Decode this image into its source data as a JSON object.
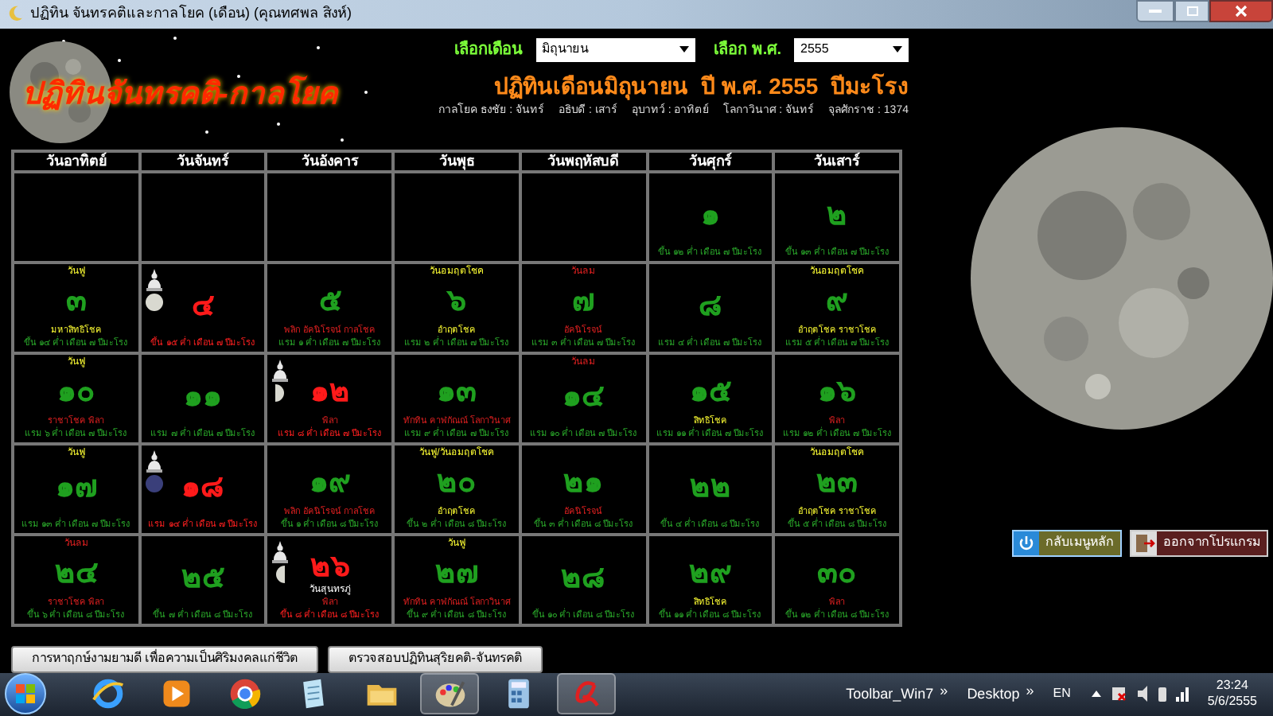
{
  "window": {
    "title": "ปฏิทิน จันทรคติและกาลโยค (เดือน) (คุณทศพล สิงห์)"
  },
  "logo": {
    "text": "ปฏิทินจันทรคติ-กาลโยค"
  },
  "month_select": {
    "label": "เลือกเดือน",
    "value": "มิถุนายน"
  },
  "year_select": {
    "label": "เลือก พ.ศ.",
    "value": "2555"
  },
  "heading": "ปฏิทินเดือนมิถุนายน  ปี พ.ศ. 2555  ปีมะโรง",
  "info": [
    "กาลโยค ธงชัย : จันทร์",
    "อธิบดี : เสาร์",
    "อุบาทว์ : อาทิตย์",
    "โลกาวินาศ : จันทร์",
    "จุลศักราช : 1374"
  ],
  "calendar": {
    "weekdays": [
      "วันอาทิตย์",
      "วันจันทร์",
      "วันอังคาร",
      "วันพุธ",
      "วันพฤหัสบดี",
      "วันศุกร์",
      "วันเสาร์"
    ],
    "weeks": [
      [
        {
          "kind": "blank"
        },
        {
          "kind": "blank"
        },
        {
          "kind": "blank"
        },
        {
          "kind": "blank"
        },
        {
          "kind": "blank"
        },
        {
          "kind": "day",
          "day": "๑",
          "lunar": "ขึ้น ๑๒ ค่ำ เดือน ๗ ปีมะโรง"
        },
        {
          "kind": "day",
          "day": "๒",
          "lunar": "ขึ้น ๑๓ ค่ำ เดือน ๗ ปีมะโรง"
        }
      ],
      [
        {
          "kind": "day",
          "day": "๓",
          "label": {
            "text": "วันฟู",
            "kind": "good"
          },
          "note": {
            "text": "มหาสิทธิโชค",
            "kind": "good"
          },
          "lunar": "ขึ้น ๑๔ ค่ำ เดือน ๗ ปีมะโรง"
        },
        {
          "kind": "day",
          "day": "๔",
          "moon": {
            "kind": "full"
          },
          "lunar": "ขึ้น ๑๕ ค่ำ เดือน ๗ ปีมะโรง"
        },
        {
          "kind": "day",
          "day": "๕",
          "note": {
            "text": "พลิก อัคนิโรจน์ กาลโชค",
            "kind": "bad"
          },
          "lunar": "แรม ๑ ค่ำ เดือน ๗ ปีมะโรง"
        },
        {
          "kind": "day",
          "day": "๖",
          "label": {
            "text": "วันอมฤตโชค",
            "kind": "good"
          },
          "note": {
            "text": "อำฤตโชค",
            "kind": "good"
          },
          "lunar": "แรม ๒ ค่ำ เดือน ๗ ปีมะโรง"
        },
        {
          "kind": "day",
          "day": "๗",
          "label": {
            "text": "วันลม",
            "kind": "bad"
          },
          "note": {
            "text": "อัคนิโรจน์",
            "kind": "bad"
          },
          "lunar": "แรม ๓ ค่ำ เดือน ๗ ปีมะโรง"
        },
        {
          "kind": "day",
          "day": "๘",
          "lunar": "แรม ๔ ค่ำ เดือน ๗ ปีมะโรง"
        },
        {
          "kind": "day",
          "day": "๙",
          "label": {
            "text": "วันอมฤตโชค",
            "kind": "good"
          },
          "note": {
            "text": "อำฤตโชค ราชาโชค",
            "kind": "good"
          },
          "lunar": "แรม ๕ ค่ำ เดือน ๗ ปีมะโรง"
        }
      ],
      [
        {
          "kind": "day",
          "day": "๑๐",
          "label": {
            "text": "วันฟู",
            "kind": "good"
          },
          "note": {
            "text": "ราชาโชค พิลา",
            "kind": "bad"
          },
          "lunar": "แรม ๖ ค่ำ เดือน ๗ ปีมะโรง"
        },
        {
          "kind": "day",
          "day": "๑๑",
          "lunar": "แรม ๗ ค่ำ เดือน ๗ ปีมะโรง"
        },
        {
          "kind": "day",
          "day": "๑๒",
          "moon": {
            "kind": "waning_half"
          },
          "note": {
            "text": "พิลา",
            "kind": "bad"
          },
          "lunar": "แรม ๘ ค่ำ เดือน ๗ ปีมะโรง"
        },
        {
          "kind": "day",
          "day": "๑๓",
          "note": {
            "text": "ทักทิน คาฬกัณณ์ โลกาวินาศ",
            "kind": "bad"
          },
          "lunar": "แรม ๙ ค่ำ เดือน ๗ ปีมะโรง"
        },
        {
          "kind": "day",
          "day": "๑๔",
          "label": {
            "text": "วันลม",
            "kind": "bad"
          },
          "lunar": "แรม ๑๐ ค่ำ เดือน ๗ ปีมะโรง"
        },
        {
          "kind": "day",
          "day": "๑๕",
          "note": {
            "text": "สิทธิโชค",
            "kind": "good"
          },
          "lunar": "แรม ๑๑ ค่ำ เดือน ๗ ปีมะโรง"
        },
        {
          "kind": "day",
          "day": "๑๖",
          "note": {
            "text": "พิลา",
            "kind": "bad"
          },
          "lunar": "แรม ๑๒ ค่ำ เดือน ๗ ปีมะโรง"
        }
      ],
      [
        {
          "kind": "day",
          "day": "๑๗",
          "label": {
            "text": "วันฟู",
            "kind": "good"
          },
          "lunar": "แรม ๑๓ ค่ำ เดือน ๗ ปีมะโรง"
        },
        {
          "kind": "day",
          "day": "๑๘",
          "moon": {
            "kind": "new"
          },
          "lunar": "แรม ๑๔ ค่ำ เดือน ๗ ปีมะโรง"
        },
        {
          "kind": "day",
          "day": "๑๙",
          "note": {
            "text": "พลิก อัคนิโรจน์ กาลโชค",
            "kind": "bad"
          },
          "lunar": "ขึ้น ๑ ค่ำ เดือน ๘ ปีมะโรง"
        },
        {
          "kind": "day",
          "day": "๒๐",
          "label": {
            "text": "วันฟู/วันอมฤตโชค",
            "kind": "good"
          },
          "note": {
            "text": "อำฤตโชค",
            "kind": "good"
          },
          "lunar": "ขึ้น ๒ ค่ำ เดือน ๘ ปีมะโรง"
        },
        {
          "kind": "day",
          "day": "๒๑",
          "note": {
            "text": "อัคนิโรจน์",
            "kind": "bad"
          },
          "lunar": "ขึ้น ๓ ค่ำ เดือน ๘ ปีมะโรง"
        },
        {
          "kind": "day",
          "day": "๒๒",
          "lunar": "ขึ้น ๔ ค่ำ เดือน ๘ ปีมะโรง"
        },
        {
          "kind": "day",
          "day": "๒๓",
          "label": {
            "text": "วันอมฤตโชค",
            "kind": "good"
          },
          "note": {
            "text": "อำฤตโชค ราชาโชค",
            "kind": "good"
          },
          "lunar": "ขึ้น ๕ ค่ำ เดือน ๘ ปีมะโรง"
        }
      ],
      [
        {
          "kind": "day",
          "day": "๒๔",
          "label": {
            "text": "วันลม",
            "kind": "bad"
          },
          "note": {
            "text": "ราชาโชค พิลา",
            "kind": "bad"
          },
          "lunar": "ขึ้น ๖ ค่ำ เดือน ๘ ปีมะโรง"
        },
        {
          "kind": "day",
          "day": "๒๕",
          "lunar": "ขึ้น ๗ ค่ำ เดือน ๘ ปีมะโรง"
        },
        {
          "kind": "day",
          "day": "๒๖",
          "moon": {
            "kind": "waxing_half"
          },
          "caption": "วันสุนทรภู่",
          "note": {
            "text": "พิลา",
            "kind": "bad"
          },
          "lunar": "ขึ้น ๘ ค่ำ เดือน ๘ ปีมะโรง"
        },
        {
          "kind": "day",
          "day": "๒๗",
          "label": {
            "text": "วันฟู",
            "kind": "good"
          },
          "note": {
            "text": "ทักทิน คาฬกัณณ์ โลกาวินาศ",
            "kind": "bad"
          },
          "lunar": "ขึ้น ๙ ค่ำ เดือน ๘ ปีมะโรง"
        },
        {
          "kind": "day",
          "day": "๒๘",
          "lunar": "ขึ้น ๑๐ ค่ำ เดือน ๘ ปีมะโรง"
        },
        {
          "kind": "day",
          "day": "๒๙",
          "note": {
            "text": "สิทธิโชค",
            "kind": "good"
          },
          "lunar": "ขึ้น ๑๑ ค่ำ เดือน ๘ ปีมะโรง"
        },
        {
          "kind": "day",
          "day": "๓๐",
          "note": {
            "text": "พิลา",
            "kind": "bad"
          },
          "lunar": "ขึ้น ๑๒ ค่ำ เดือน ๘ ปีมะโรง"
        }
      ]
    ]
  },
  "bottom_buttons": [
    "การหาฤกษ์งามยามดี เพื่อความเป็นศิริมงคลแก่ชีวิต",
    "ตรวจสอบปฏิทินสุริยคติ-จันทรคติ"
  ],
  "nav_buttons": [
    {
      "kind": "home",
      "label": "กลับเมนูหลัก"
    },
    {
      "kind": "exit",
      "label": "ออกจากโปรแกรม"
    }
  ],
  "taskbar": {
    "apps": [
      {
        "kind": "ie",
        "selected": false
      },
      {
        "kind": "media",
        "selected": false
      },
      {
        "kind": "chrome",
        "selected": false
      },
      {
        "kind": "notepad",
        "selected": false
      },
      {
        "kind": "folder",
        "selected": false
      },
      {
        "kind": "paint",
        "selected": true
      },
      {
        "kind": "calc",
        "selected": false
      },
      {
        "kind": "alpha",
        "selected": true
      }
    ],
    "toolbars": [
      "Toolbar_Win7",
      "Desktop"
    ],
    "chevron": "»",
    "language": "EN",
    "time": "23:24",
    "date": "5/6/2555"
  }
}
